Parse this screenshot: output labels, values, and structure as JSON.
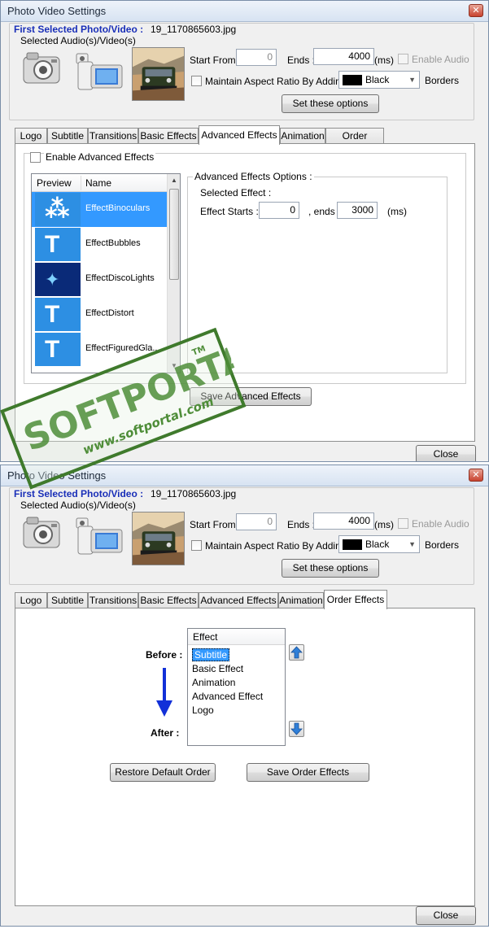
{
  "window": {
    "title": "Photo Video Settings",
    "close_glyph": "✕"
  },
  "header": {
    "first_selected_label": "First Selected Photo/Video :",
    "first_selected_value": "19_1170865603.jpg",
    "selected_audio_label": "Selected Audio(s)/Video(s)",
    "start_from_label": "Start From :",
    "start_from_value": "0",
    "ends_label": "Ends :",
    "ends_value": "4000",
    "ms_label": "(ms)",
    "enable_audio_label": "Enable Audio",
    "maintain_aspect_label": "Maintain Aspect Ratio By Adding",
    "border_color_value": "Black",
    "borders_label": "Borders",
    "set_options_button": "Set these options",
    "icons": [
      "camera-icon",
      "video-camera-icon",
      "photo-thumbnail"
    ]
  },
  "tabs": [
    "Logo",
    "Subtitle",
    "Transitions",
    "Basic Effects",
    "Advanced Effects",
    "Animation",
    "Order Effects"
  ],
  "advanced": {
    "enable_label": "Enable Advanced Effects",
    "list_headers": [
      "Preview",
      "Name"
    ],
    "effects": [
      {
        "name": "EffectBinoculars",
        "icon": "binoculars-effect-icon",
        "glyph": "⁂"
      },
      {
        "name": "EffectBubbles",
        "icon": "bubbles-effect-icon",
        "glyph": "T"
      },
      {
        "name": "EffectDiscoLights",
        "icon": "disco-lights-effect-icon",
        "glyph": "✦"
      },
      {
        "name": "EffectDistort",
        "icon": "distort-effect-icon",
        "glyph": "T"
      },
      {
        "name": "EffectFiguredGla...",
        "icon": "figured-glass-effect-icon",
        "glyph": "T"
      }
    ],
    "options_legend": "Advanced Effects Options :",
    "selected_effect_label": "Selected Effect :",
    "effect_starts_label": "Effect Starts :",
    "effect_starts_value": "0",
    "ends_label": ", ends :",
    "ends_value": "3000",
    "ms_label": "(ms)",
    "save_button": "Save Advanced Effects"
  },
  "order": {
    "column_header": "Effect",
    "items": [
      "Subtitle",
      "Basic Effect",
      "Animation",
      "Advanced Effect",
      "Logo"
    ],
    "before_label": "Before :",
    "after_label": "After :",
    "restore_button": "Restore Default Order",
    "save_button": "Save Order Effects"
  },
  "footer": {
    "close_button": "Close"
  },
  "watermark": {
    "brand": "SOFTPORTAL",
    "trademark": "TM",
    "url": "www.softportal.com"
  },
  "colors": {
    "accent_blue": "#1a2fb8",
    "selection": "#3399ff",
    "arrow_blue": "#1230d8"
  }
}
